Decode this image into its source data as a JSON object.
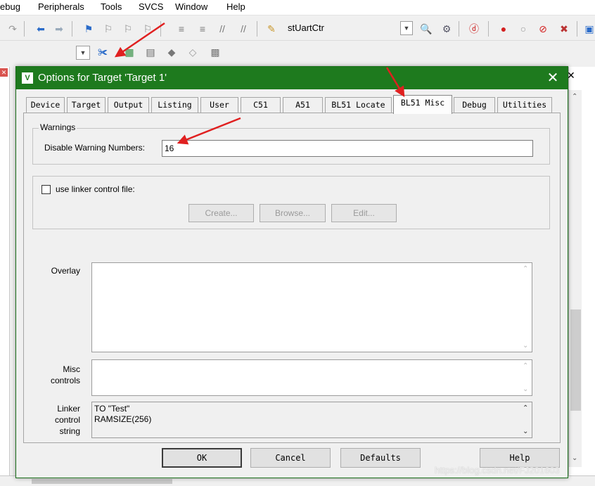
{
  "menubar": {
    "items": [
      "ebug",
      "Peripherals",
      "Tools",
      "SVCS",
      "Window",
      "Help"
    ]
  },
  "toolbar": {
    "target_name": "stUartCtr"
  },
  "dialog": {
    "title": "Options for Target 'Target 1'",
    "tabs": [
      "Device",
      "Target",
      "Output",
      "Listing",
      "User",
      "C51",
      "A51",
      "BL51 Locate",
      "BL51 Misc",
      "Debug",
      "Utilities"
    ],
    "active_tab": "BL51 Misc",
    "warnings": {
      "group_title": "Warnings",
      "label": "Disable Warning Numbers:",
      "value": "16"
    },
    "linker_file": {
      "checkbox_label": "use linker control file:",
      "checked": false,
      "buttons": [
        "Create...",
        "Browse...",
        "Edit..."
      ]
    },
    "overlay": {
      "label": "Overlay",
      "value": ""
    },
    "misc_controls": {
      "label_line1": "Misc",
      "label_line2": "controls",
      "value": ""
    },
    "linker_control_string": {
      "label_line1": "Linker",
      "label_line2": "control",
      "label_line3": "string",
      "line1": "TO \"Test\"",
      "line2": "RAMSIZE(256)"
    },
    "buttons": {
      "ok": "OK",
      "cancel": "Cancel",
      "defaults": "Defaults",
      "help": "Help"
    }
  },
  "watermark": "https://blog.csdn.net/FJ201603",
  "colors": {
    "titlebar": "#1e7a1e",
    "arrow": "#e02020"
  }
}
